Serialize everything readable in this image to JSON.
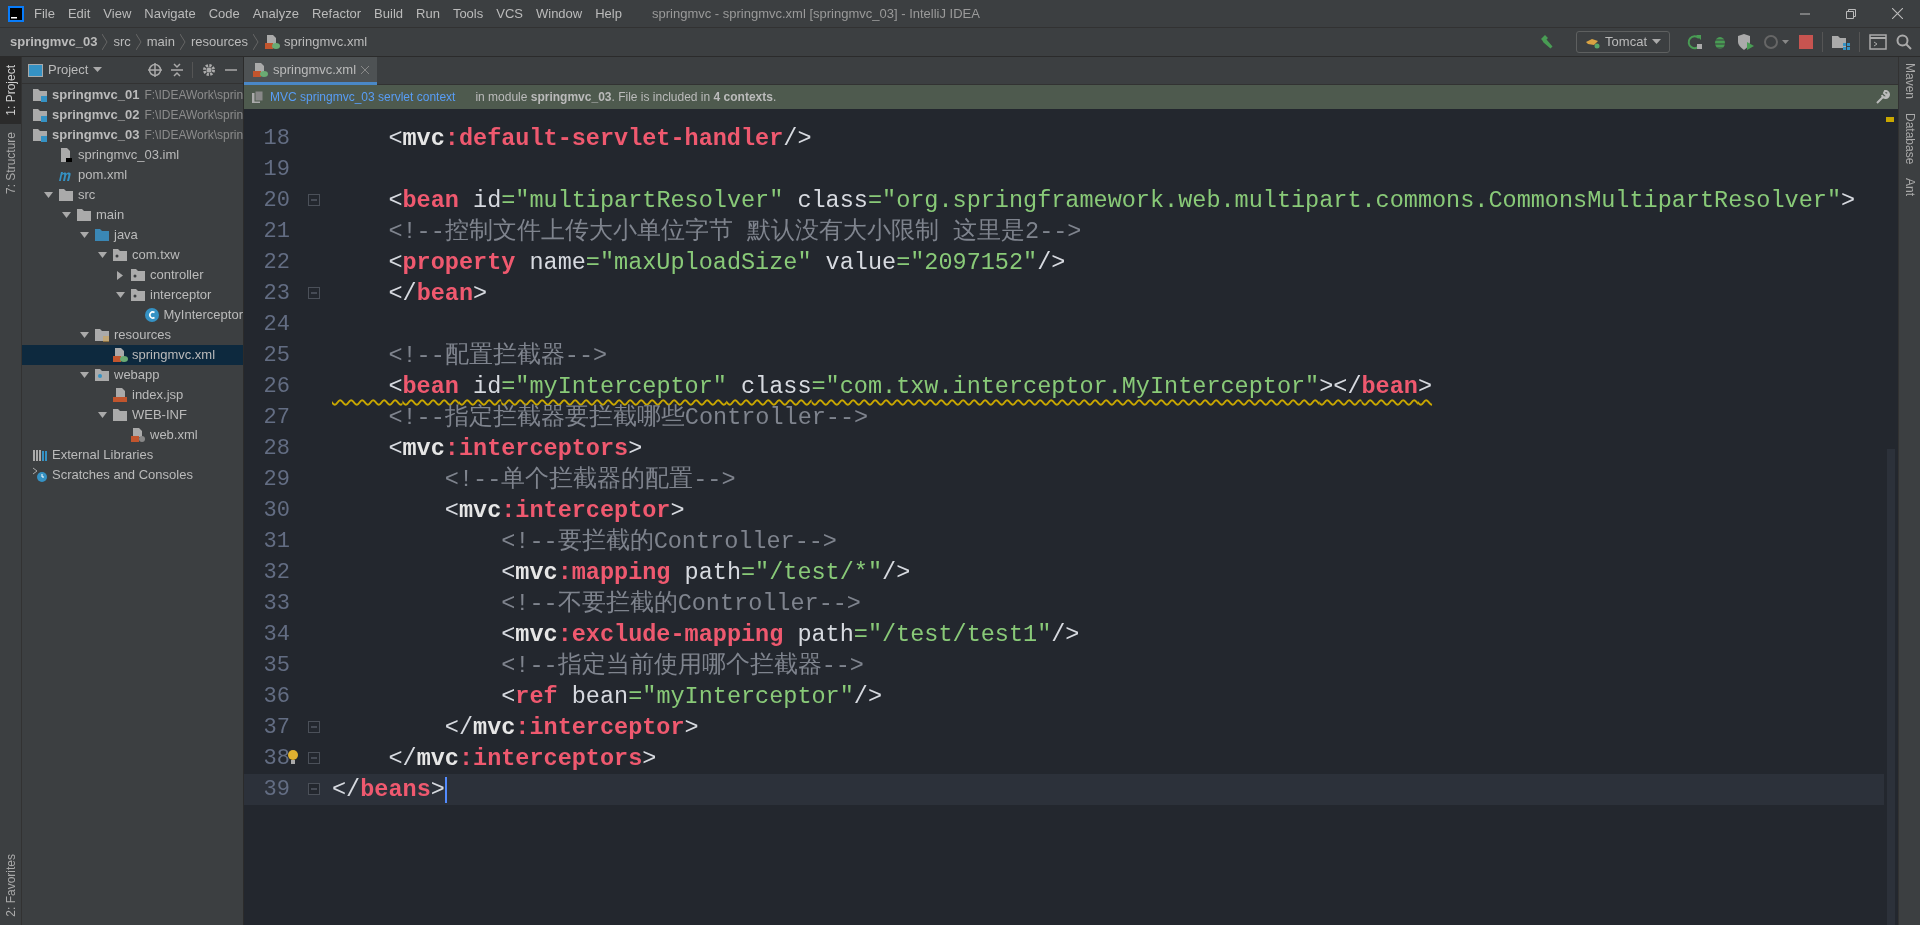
{
  "window": {
    "title": "springmvc - springmvc.xml [springmvc_03] - IntelliJ IDEA"
  },
  "menu": [
    "File",
    "Edit",
    "View",
    "Navigate",
    "Code",
    "Analyze",
    "Refactor",
    "Build",
    "Run",
    "Tools",
    "VCS",
    "Window",
    "Help"
  ],
  "breadcrumbs": [
    {
      "label": "springmvc_03",
      "kind": "project"
    },
    {
      "label": "src",
      "kind": "folder"
    },
    {
      "label": "main",
      "kind": "folder"
    },
    {
      "label": "resources",
      "kind": "folder"
    },
    {
      "label": "springmvc.xml",
      "kind": "xml"
    }
  ],
  "toolbar": {
    "run_config": "Tomcat"
  },
  "left_strip": [
    {
      "label": "1: Project",
      "selected": true
    },
    {
      "label": "7: Structure",
      "selected": false
    }
  ],
  "left_strip_bottom": [
    {
      "label": "2: Favorites",
      "selected": false
    }
  ],
  "right_strip": [
    "Maven",
    "Database",
    "Ant"
  ],
  "project_panel": {
    "title": "Project",
    "tree": [
      {
        "label": "springmvc_01",
        "path": "F:\\IDEAWork\\sprin",
        "kind": "module",
        "selected": false
      },
      {
        "label": "springmvc_02",
        "path": "F:\\IDEAWork\\sprin",
        "kind": "module",
        "selected": false
      },
      {
        "label": "springmvc_03",
        "path": "F:\\IDEAWork\\sprin",
        "kind": "module",
        "selected": false,
        "children": [
          {
            "label": "springmvc_03.iml",
            "kind": "iml",
            "selected": false
          },
          {
            "label": "pom.xml",
            "kind": "pom",
            "selected": false
          },
          {
            "label": "src",
            "kind": "folder",
            "expanded": true,
            "selected": false,
            "children": [
              {
                "label": "main",
                "kind": "folder",
                "expanded": true,
                "selected": false,
                "children": [
                  {
                    "label": "java",
                    "kind": "source",
                    "expanded": true,
                    "selected": false,
                    "children": [
                      {
                        "label": "com.txw",
                        "kind": "package",
                        "expanded": true,
                        "selected": false,
                        "children": [
                          {
                            "label": "controller",
                            "kind": "package",
                            "expanded": false,
                            "selected": false
                          },
                          {
                            "label": "interceptor",
                            "kind": "package",
                            "expanded": true,
                            "selected": false,
                            "children": [
                              {
                                "label": "MyInterceptor",
                                "kind": "class",
                                "selected": false
                              }
                            ]
                          }
                        ]
                      }
                    ]
                  },
                  {
                    "label": "resources",
                    "kind": "resources",
                    "expanded": true,
                    "selected": false,
                    "children": [
                      {
                        "label": "springmvc.xml",
                        "kind": "xml",
                        "selected": true
                      }
                    ]
                  },
                  {
                    "label": "webapp",
                    "kind": "webapp",
                    "expanded": true,
                    "selected": false,
                    "children": [
                      {
                        "label": "index.jsp",
                        "kind": "jsp",
                        "selected": false
                      },
                      {
                        "label": "WEB-INF",
                        "kind": "folder",
                        "expanded": true,
                        "selected": false,
                        "children": [
                          {
                            "label": "web.xml",
                            "kind": "webxml",
                            "selected": false
                          }
                        ]
                      }
                    ]
                  }
                ]
              }
            ]
          }
        ]
      },
      {
        "label": "External Libraries",
        "kind": "libraries",
        "selected": false
      },
      {
        "label": "Scratches and Consoles",
        "kind": "scratches",
        "selected": false
      }
    ]
  },
  "tabs": [
    {
      "label": "springmvc.xml",
      "selected": true
    }
  ],
  "banner": {
    "link": "MVC springmvc_03 servlet context",
    "text": "in module **springmvc_03**. File is included in **4 contexts**."
  },
  "code": [
    {
      "number": "18",
      "fold": false,
      "warning": false,
      "current": false,
      "tokens": [
        {
          "kind": "bracket",
          "text": "    <"
        },
        {
          "kind": "ns",
          "text": "mvc"
        },
        {
          "kind": "tag",
          "text": ":default-servlet-handler"
        },
        {
          "kind": "bracket",
          "text": "/>"
        }
      ]
    },
    {
      "number": "19",
      "fold": false,
      "current": false
    },
    {
      "number": "20",
      "fold": true,
      "warning": false,
      "current": false,
      "tokens": [
        {
          "kind": "bracket",
          "text": "    <"
        },
        {
          "kind": "tag",
          "text": "bean"
        },
        {
          "kind": "attr",
          "text": " id"
        },
        {
          "kind": "value",
          "text": "=\"multipartResolver\""
        },
        {
          "kind": "attr",
          "text": " class"
        },
        {
          "kind": "value",
          "text": "=\"org.springframework.web.multipart.commons.CommonsMultipartResolver\""
        },
        {
          "kind": "bracket",
          "text": ">"
        }
      ]
    },
    {
      "number": "21",
      "fold": false,
      "warning": false,
      "current": false,
      "tokens": [
        {
          "kind": "comment",
          "text": "    <!--控制文件上传大小单位字节 默认没有大小限制 这里是2-->"
        }
      ]
    },
    {
      "number": "22",
      "fold": false,
      "warning": false,
      "current": false,
      "tokens": [
        {
          "kind": "bracket",
          "text": "    <"
        },
        {
          "kind": "tag",
          "text": "property"
        },
        {
          "kind": "attr",
          "text": " name"
        },
        {
          "kind": "value",
          "text": "=\"maxUploadSize\""
        },
        {
          "kind": "attr",
          "text": " value"
        },
        {
          "kind": "value",
          "text": "=\"2097152\""
        },
        {
          "kind": "bracket",
          "text": "/>"
        }
      ]
    },
    {
      "number": "23",
      "fold": true,
      "warning": false,
      "current": false,
      "tokens": [
        {
          "kind": "bracket",
          "text": "    </"
        },
        {
          "kind": "tag",
          "text": "bean"
        },
        {
          "kind": "bracket",
          "text": ">"
        }
      ]
    },
    {
      "number": "24",
      "fold": false,
      "current": false
    },
    {
      "number": "25",
      "fold": false,
      "warning": false,
      "current": false,
      "tokens": [
        {
          "kind": "comment",
          "text": "    <!--配置拦截器-->"
        }
      ]
    },
    {
      "number": "26",
      "fold": false,
      "warning": true,
      "current": false,
      "tokens": [
        {
          "kind": "bracket",
          "text": "    <"
        },
        {
          "kind": "tag",
          "text": "bean"
        },
        {
          "kind": "attr",
          "text": " id"
        },
        {
          "kind": "value",
          "text": "=\"myInterceptor\""
        },
        {
          "kind": "attr",
          "text": " class"
        },
        {
          "kind": "value",
          "text": "=\"com.txw.interceptor.MyInterceptor\""
        },
        {
          "kind": "bracket",
          "text": "></"
        },
        {
          "kind": "tag",
          "text": "bean"
        },
        {
          "kind": "bracket",
          "text": ">"
        }
      ]
    },
    {
      "number": "27",
      "fold": false,
      "warning": false,
      "current": false,
      "tokens": [
        {
          "kind": "comment",
          "text": "    <!--指定拦截器要拦截哪些Controller-->"
        }
      ]
    },
    {
      "number": "28",
      "fold": false,
      "warning": false,
      "current": false,
      "tokens": [
        {
          "kind": "bracket",
          "text": "    <"
        },
        {
          "kind": "ns",
          "text": "mvc"
        },
        {
          "kind": "tag",
          "text": ":interceptors"
        },
        {
          "kind": "bracket",
          "text": ">"
        }
      ]
    },
    {
      "number": "29",
      "fold": false,
      "warning": false,
      "current": false,
      "tokens": [
        {
          "kind": "comment",
          "text": "        <!--单个拦截器的配置-->"
        }
      ]
    },
    {
      "number": "30",
      "fold": false,
      "warning": false,
      "current": false,
      "tokens": [
        {
          "kind": "bracket",
          "text": "        <"
        },
        {
          "kind": "ns",
          "text": "mvc"
        },
        {
          "kind": "tag",
          "text": ":interceptor"
        },
        {
          "kind": "bracket",
          "text": ">"
        }
      ]
    },
    {
      "number": "31",
      "fold": false,
      "warning": false,
      "current": false,
      "tokens": [
        {
          "kind": "comment",
          "text": "            <!--要拦截的Controller-->"
        }
      ]
    },
    {
      "number": "32",
      "fold": false,
      "warning": false,
      "current": false,
      "tokens": [
        {
          "kind": "bracket",
          "text": "            <"
        },
        {
          "kind": "ns",
          "text": "mvc"
        },
        {
          "kind": "tag",
          "text": ":mapping"
        },
        {
          "kind": "attr",
          "text": " path"
        },
        {
          "kind": "value",
          "text": "=\"/test/*\""
        },
        {
          "kind": "bracket",
          "text": "/>"
        }
      ]
    },
    {
      "number": "33",
      "fold": false,
      "warning": false,
      "current": false,
      "tokens": [
        {
          "kind": "comment",
          "text": "            <!--不要拦截的Controller-->"
        }
      ]
    },
    {
      "number": "34",
      "fold": false,
      "warning": false,
      "current": false,
      "tokens": [
        {
          "kind": "bracket",
          "text": "            <"
        },
        {
          "kind": "ns",
          "text": "mvc"
        },
        {
          "kind": "tag",
          "text": ":exclude-mapping"
        },
        {
          "kind": "attr",
          "text": " path"
        },
        {
          "kind": "value",
          "text": "=\"/test/test1\""
        },
        {
          "kind": "bracket",
          "text": "/>"
        }
      ]
    },
    {
      "number": "35",
      "fold": false,
      "warning": false,
      "current": false,
      "tokens": [
        {
          "kind": "comment",
          "text": "            <!--指定当前使用哪个拦截器-->"
        }
      ]
    },
    {
      "number": "36",
      "fold": false,
      "warning": false,
      "current": false,
      "tokens": [
        {
          "kind": "bracket",
          "text": "            <"
        },
        {
          "kind": "tag",
          "text": "ref"
        },
        {
          "kind": "attr",
          "text": " bean"
        },
        {
          "kind": "value",
          "text": "=\"myInterceptor\""
        },
        {
          "kind": "bracket",
          "text": "/>"
        }
      ]
    },
    {
      "number": "37",
      "fold": true,
      "warning": false,
      "current": false,
      "tokens": [
        {
          "kind": "bracket",
          "text": "        </"
        },
        {
          "kind": "ns",
          "text": "mvc"
        },
        {
          "kind": "tag",
          "text": ":interceptor"
        },
        {
          "kind": "bracket",
          "text": ">"
        }
      ]
    },
    {
      "number": "38",
      "fold": true,
      "warning": false,
      "current": false,
      "hint": true,
      "tokens": [
        {
          "kind": "bracket",
          "text": "    </"
        },
        {
          "kind": "ns",
          "text": "mvc"
        },
        {
          "kind": "tag",
          "text": ":interceptors"
        },
        {
          "kind": "bracket",
          "text": ">"
        }
      ]
    },
    {
      "number": "39",
      "fold": true,
      "warning": false,
      "current": true,
      "tokens": [
        {
          "kind": "bracket",
          "text": "</"
        },
        {
          "kind": "tag",
          "text": "beans"
        },
        {
          "kind": "bracket",
          "text": ">"
        }
      ]
    }
  ]
}
